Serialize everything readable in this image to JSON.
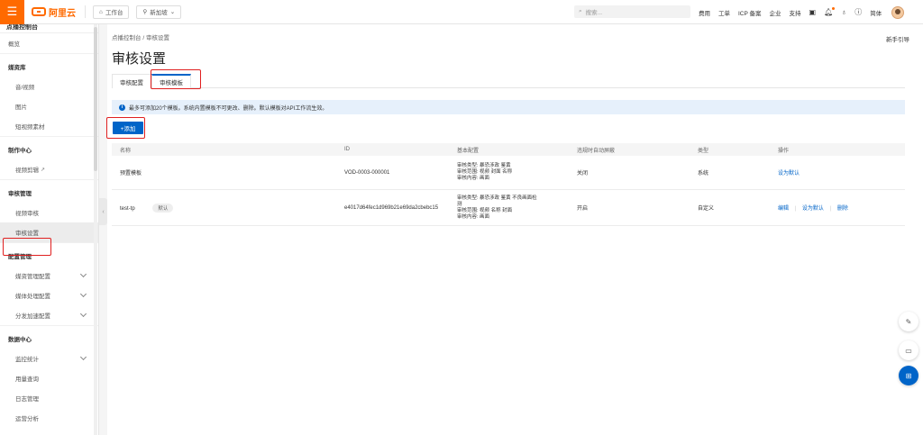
{
  "topbar": {
    "logo_text": "阿里云",
    "workbench": "工作台",
    "region": "新加坡",
    "search_placeholder": "搜索...",
    "links": [
      "费用",
      "工单",
      "ICP 备案",
      "企业",
      "支持"
    ],
    "language": "简体"
  },
  "sidebar": {
    "title": "点播控制台",
    "overview": "概览",
    "groups": [
      {
        "label": "媒资库",
        "items": [
          "音/视频",
          "图片",
          "短视频素材"
        ]
      },
      {
        "label": "制作中心",
        "items": [
          "视频剪辑"
        ]
      },
      {
        "label": "审核管理",
        "items": [
          "视频审核",
          "审核设置"
        ]
      },
      {
        "label": "配置管理",
        "items": [
          "媒资管理配置",
          "媒体处理配置",
          "分发加速配置"
        ]
      },
      {
        "label": "数据中心",
        "items": [
          "监控统计",
          "用量查询",
          "日志管理",
          "运营分析"
        ]
      }
    ]
  },
  "main": {
    "breadcrumb": [
      "点播控制台",
      "审核设置"
    ],
    "help_link": "新手引导",
    "page_title": "审核设置",
    "tabs": [
      "审核配置",
      "审核模板"
    ],
    "active_tab": "审核模板",
    "notice": "最多可添加20个模板。系统内置模板不可更改、删除。默认模板对API工作流生效。",
    "add_button": "+添加",
    "table": {
      "headers": [
        "名称",
        "ID",
        "基本配置",
        "违规时自动屏蔽",
        "类型",
        "操作"
      ],
      "rows": [
        {
          "name": "预置模板",
          "tag": "",
          "id": "VOD-0003-000001",
          "config": [
            "审核类型: 暴恐涉政  鉴黄",
            "审核范围: 视频  封面  名称",
            "审核内容: 画面"
          ],
          "block": "关闭",
          "type": "系统",
          "actions": [
            "设为默认"
          ]
        },
        {
          "name": "test-tp",
          "tag": "默认",
          "id": "e4017d64fec1d969b21e69da2cbebc15",
          "config": [
            "审核类型: 暴恐涉政  鉴黄  不良画面检",
            "测",
            "审核范围: 视频  名称  封面",
            "审核内容: 画面"
          ],
          "block": "开启",
          "type": "自定义",
          "actions": [
            "编辑",
            "设为默认",
            "删除"
          ]
        }
      ]
    }
  },
  "colors": {
    "brand_orange": "#ff6a00",
    "primary_blue": "#0064c8",
    "highlight_red": "#e02020"
  }
}
